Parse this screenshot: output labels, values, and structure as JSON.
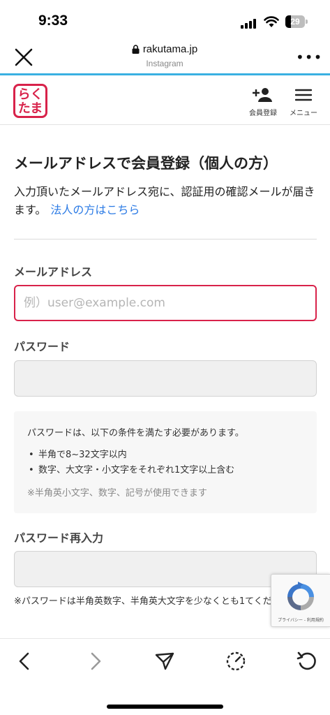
{
  "status_bar": {
    "time": "9:33",
    "battery": "29",
    "battery_level": 0.29
  },
  "browser": {
    "domain": "rakutama.jp",
    "source": "Instagram"
  },
  "site_header": {
    "logo_line1": "らく",
    "logo_line2": "たま",
    "member_label": "会員登録",
    "menu_label": "メニュー"
  },
  "page": {
    "title": "メールアドレスで会員登録（個人の方）",
    "intro": "入力頂いたメールアドレス宛に、認証用の確認メールが届きます。",
    "corporate_link": "法人の方はこちら"
  },
  "form": {
    "email_label": "メールアドレス",
    "email_placeholder": "例）user@example.com",
    "email_value": "",
    "password_label": "パスワード",
    "password_value": "",
    "password_confirm_label": "パスワード再入力",
    "password_confirm_value": ""
  },
  "password_rules": {
    "intro": "パスワードは、以下の条件を満たす必要があります。",
    "items": [
      "半角で8~32文字以内",
      "数字、大文字・小文字をそれぞれ1文字以上含む"
    ],
    "note": "※半角英小文字、数字、記号が使用できます"
  },
  "bottom_note": "※パスワードは半角英数字、半角英大文字を少なくとも1てください。",
  "recaptcha": {
    "text": "プライバシー - 利用規約"
  },
  "colors": {
    "brand": "#d8224a",
    "link": "#2c7be5",
    "progress": "#3ab0e2"
  }
}
